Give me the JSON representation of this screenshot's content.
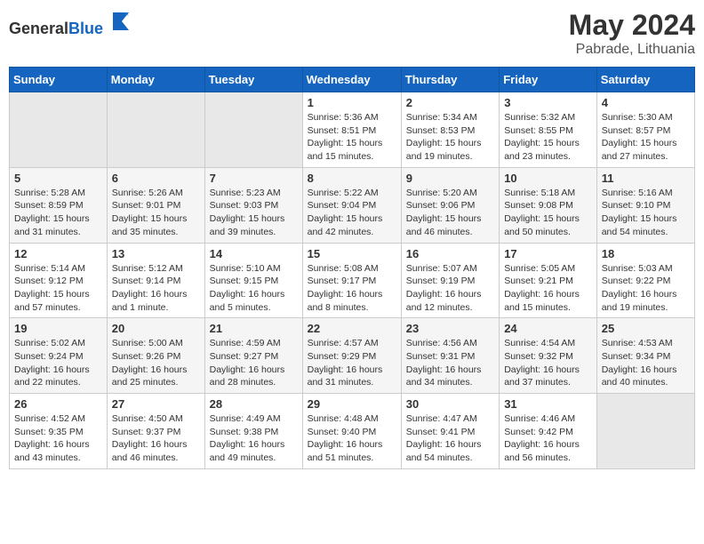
{
  "header": {
    "logo_general": "General",
    "logo_blue": "Blue",
    "month_year": "May 2024",
    "location": "Pabrade, Lithuania"
  },
  "weekdays": [
    "Sunday",
    "Monday",
    "Tuesday",
    "Wednesday",
    "Thursday",
    "Friday",
    "Saturday"
  ],
  "weeks": [
    [
      {
        "day": "",
        "sunrise": "",
        "sunset": "",
        "daylight": ""
      },
      {
        "day": "",
        "sunrise": "",
        "sunset": "",
        "daylight": ""
      },
      {
        "day": "",
        "sunrise": "",
        "sunset": "",
        "daylight": ""
      },
      {
        "day": "1",
        "sunrise": "Sunrise: 5:36 AM",
        "sunset": "Sunset: 8:51 PM",
        "daylight": "Daylight: 15 hours and 15 minutes."
      },
      {
        "day": "2",
        "sunrise": "Sunrise: 5:34 AM",
        "sunset": "Sunset: 8:53 PM",
        "daylight": "Daylight: 15 hours and 19 minutes."
      },
      {
        "day": "3",
        "sunrise": "Sunrise: 5:32 AM",
        "sunset": "Sunset: 8:55 PM",
        "daylight": "Daylight: 15 hours and 23 minutes."
      },
      {
        "day": "4",
        "sunrise": "Sunrise: 5:30 AM",
        "sunset": "Sunset: 8:57 PM",
        "daylight": "Daylight: 15 hours and 27 minutes."
      }
    ],
    [
      {
        "day": "5",
        "sunrise": "Sunrise: 5:28 AM",
        "sunset": "Sunset: 8:59 PM",
        "daylight": "Daylight: 15 hours and 31 minutes."
      },
      {
        "day": "6",
        "sunrise": "Sunrise: 5:26 AM",
        "sunset": "Sunset: 9:01 PM",
        "daylight": "Daylight: 15 hours and 35 minutes."
      },
      {
        "day": "7",
        "sunrise": "Sunrise: 5:23 AM",
        "sunset": "Sunset: 9:03 PM",
        "daylight": "Daylight: 15 hours and 39 minutes."
      },
      {
        "day": "8",
        "sunrise": "Sunrise: 5:22 AM",
        "sunset": "Sunset: 9:04 PM",
        "daylight": "Daylight: 15 hours and 42 minutes."
      },
      {
        "day": "9",
        "sunrise": "Sunrise: 5:20 AM",
        "sunset": "Sunset: 9:06 PM",
        "daylight": "Daylight: 15 hours and 46 minutes."
      },
      {
        "day": "10",
        "sunrise": "Sunrise: 5:18 AM",
        "sunset": "Sunset: 9:08 PM",
        "daylight": "Daylight: 15 hours and 50 minutes."
      },
      {
        "day": "11",
        "sunrise": "Sunrise: 5:16 AM",
        "sunset": "Sunset: 9:10 PM",
        "daylight": "Daylight: 15 hours and 54 minutes."
      }
    ],
    [
      {
        "day": "12",
        "sunrise": "Sunrise: 5:14 AM",
        "sunset": "Sunset: 9:12 PM",
        "daylight": "Daylight: 15 hours and 57 minutes."
      },
      {
        "day": "13",
        "sunrise": "Sunrise: 5:12 AM",
        "sunset": "Sunset: 9:14 PM",
        "daylight": "Daylight: 16 hours and 1 minute."
      },
      {
        "day": "14",
        "sunrise": "Sunrise: 5:10 AM",
        "sunset": "Sunset: 9:15 PM",
        "daylight": "Daylight: 16 hours and 5 minutes."
      },
      {
        "day": "15",
        "sunrise": "Sunrise: 5:08 AM",
        "sunset": "Sunset: 9:17 PM",
        "daylight": "Daylight: 16 hours and 8 minutes."
      },
      {
        "day": "16",
        "sunrise": "Sunrise: 5:07 AM",
        "sunset": "Sunset: 9:19 PM",
        "daylight": "Daylight: 16 hours and 12 minutes."
      },
      {
        "day": "17",
        "sunrise": "Sunrise: 5:05 AM",
        "sunset": "Sunset: 9:21 PM",
        "daylight": "Daylight: 16 hours and 15 minutes."
      },
      {
        "day": "18",
        "sunrise": "Sunrise: 5:03 AM",
        "sunset": "Sunset: 9:22 PM",
        "daylight": "Daylight: 16 hours and 19 minutes."
      }
    ],
    [
      {
        "day": "19",
        "sunrise": "Sunrise: 5:02 AM",
        "sunset": "Sunset: 9:24 PM",
        "daylight": "Daylight: 16 hours and 22 minutes."
      },
      {
        "day": "20",
        "sunrise": "Sunrise: 5:00 AM",
        "sunset": "Sunset: 9:26 PM",
        "daylight": "Daylight: 16 hours and 25 minutes."
      },
      {
        "day": "21",
        "sunrise": "Sunrise: 4:59 AM",
        "sunset": "Sunset: 9:27 PM",
        "daylight": "Daylight: 16 hours and 28 minutes."
      },
      {
        "day": "22",
        "sunrise": "Sunrise: 4:57 AM",
        "sunset": "Sunset: 9:29 PM",
        "daylight": "Daylight: 16 hours and 31 minutes."
      },
      {
        "day": "23",
        "sunrise": "Sunrise: 4:56 AM",
        "sunset": "Sunset: 9:31 PM",
        "daylight": "Daylight: 16 hours and 34 minutes."
      },
      {
        "day": "24",
        "sunrise": "Sunrise: 4:54 AM",
        "sunset": "Sunset: 9:32 PM",
        "daylight": "Daylight: 16 hours and 37 minutes."
      },
      {
        "day": "25",
        "sunrise": "Sunrise: 4:53 AM",
        "sunset": "Sunset: 9:34 PM",
        "daylight": "Daylight: 16 hours and 40 minutes."
      }
    ],
    [
      {
        "day": "26",
        "sunrise": "Sunrise: 4:52 AM",
        "sunset": "Sunset: 9:35 PM",
        "daylight": "Daylight: 16 hours and 43 minutes."
      },
      {
        "day": "27",
        "sunrise": "Sunrise: 4:50 AM",
        "sunset": "Sunset: 9:37 PM",
        "daylight": "Daylight: 16 hours and 46 minutes."
      },
      {
        "day": "28",
        "sunrise": "Sunrise: 4:49 AM",
        "sunset": "Sunset: 9:38 PM",
        "daylight": "Daylight: 16 hours and 49 minutes."
      },
      {
        "day": "29",
        "sunrise": "Sunrise: 4:48 AM",
        "sunset": "Sunset: 9:40 PM",
        "daylight": "Daylight: 16 hours and 51 minutes."
      },
      {
        "day": "30",
        "sunrise": "Sunrise: 4:47 AM",
        "sunset": "Sunset: 9:41 PM",
        "daylight": "Daylight: 16 hours and 54 minutes."
      },
      {
        "day": "31",
        "sunrise": "Sunrise: 4:46 AM",
        "sunset": "Sunset: 9:42 PM",
        "daylight": "Daylight: 16 hours and 56 minutes."
      },
      {
        "day": "",
        "sunrise": "",
        "sunset": "",
        "daylight": ""
      }
    ]
  ]
}
